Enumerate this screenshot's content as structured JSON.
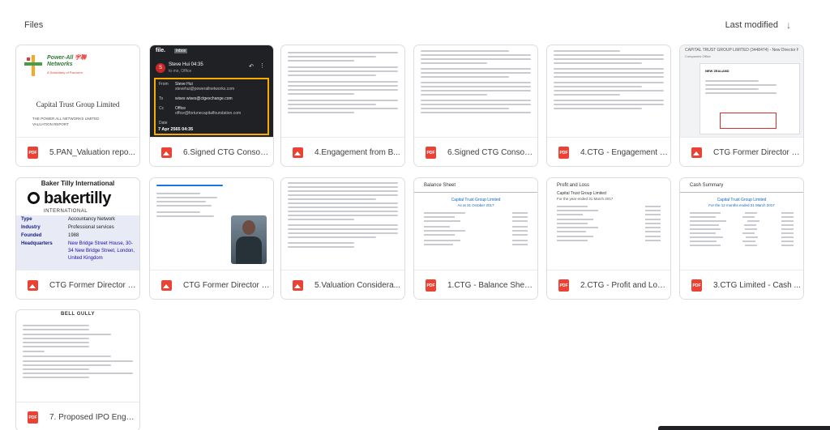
{
  "header": {
    "title": "Files",
    "sort_label": "Last modified",
    "sort_icon": "arrow-down-icon"
  },
  "files": [
    {
      "name": "5.PAN_Valuation repo...",
      "type": "pdf"
    },
    {
      "name": "6.Signed CTG Consort...",
      "type": "image"
    },
    {
      "name": "4.Engagement from B...",
      "type": "image"
    },
    {
      "name": "6.Signed CTG Consort...",
      "type": "pdf"
    },
    {
      "name": "4.CTG - Engagement L...",
      "type": "pdf"
    },
    {
      "name": "CTG Former Director - ...",
      "type": "image"
    },
    {
      "name": "CTG Former Director - ...",
      "type": "image"
    },
    {
      "name": "CTG Former Director - ...",
      "type": "image"
    },
    {
      "name": "5.Valuation Considera...",
      "type": "image"
    },
    {
      "name": "1.CTG - Balance Sheet...",
      "type": "pdf"
    },
    {
      "name": "2.CTG - Profit and Los...",
      "type": "pdf"
    },
    {
      "name": "3.CTG Limited - Cash ...",
      "type": "pdf"
    },
    {
      "name": "7. Proposed IPO Enga...",
      "type": "pdf"
    }
  ],
  "thumb1": {
    "logo_line1": "Power-All",
    "logo_line2": "Networks",
    "logo_cn": "宇聯",
    "logo_sub": "A Subsidiary of Pacnorm",
    "title": "Capital Trust Group Limited",
    "valuation1": "THE POWER ALL NETWORKS LIMITED",
    "valuation2": "VALUATION REPORT"
  },
  "thumb2": {
    "app": "file.",
    "inbox": "Inbox",
    "avatar_letter": "S",
    "sender": "Steve Hui  04:35",
    "to_line": "to me, Office",
    "from_label": "From",
    "from_name": "Steve Hui",
    "from_email": "stevehui@powerallnetworks.com",
    "to_label": "To",
    "to_value": "wises  wises@ctgexchange.com",
    "cc_label": "Cc",
    "cc_value": "Office",
    "cc_email": "office@fortunecapitalfoundation.com",
    "date_label": "Date",
    "date_value": "7 Apr 2565 04:35"
  },
  "thumb_bt": {
    "header": "Baker Tilly International",
    "logo": "bakertilly",
    "intl": "INTERNATIONAL",
    "rows": [
      {
        "k": "Type",
        "v": "Accountancy Network"
      },
      {
        "k": "Industry",
        "v": "Professional services"
      },
      {
        "k": "Founded",
        "v": "1988"
      },
      {
        "k": "Headquarters",
        "v": "New Bridge Street House, 30-"
      },
      {
        "k": "",
        "v": "34 New Bridge Street, London,"
      },
      {
        "k": "",
        "v": "United Kingdom"
      }
    ]
  },
  "thumb_fin": {
    "bs_header": "Balance Sheet",
    "bs_title": "Capital Trust Group Limited",
    "bs_sub": "As at 31 October 2017",
    "pl_header": "Profit and Loss",
    "pl_title": "Capital Trust Group Limited",
    "pl_sub": "For the year ended 31 March 2017",
    "cs_header": "Cash Summary",
    "cs_title": "Capital Trust Group Limited",
    "cs_sub": "For the 12 months ended 31 March 2017"
  },
  "thumb_dir": {
    "title": "CAPITAL TRUST GROUP LIMITED (3448474) - New Director Pending",
    "sub": "Companies Office",
    "nz": "NEW ZEALAND"
  },
  "thumb_bell": {
    "header": "BELL GULLY"
  }
}
